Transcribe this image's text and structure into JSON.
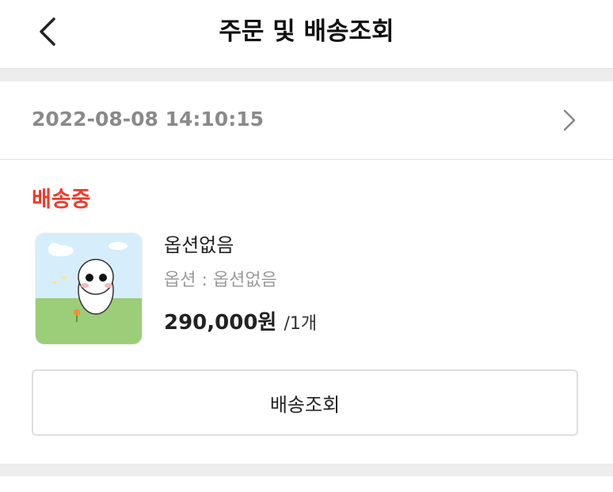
{
  "header": {
    "title": "주문 및 배송조회"
  },
  "order": {
    "date": "2022-08-08 14:10:15"
  },
  "item": {
    "status": "배송중",
    "name": "옵션없음",
    "option": "옵션 : 옵션없음",
    "price": "290,000원",
    "quantity": "/1개"
  },
  "actions": {
    "track_label": "배송조회"
  },
  "colors": {
    "status": "#ef3b2c",
    "divider": "#ededed"
  }
}
